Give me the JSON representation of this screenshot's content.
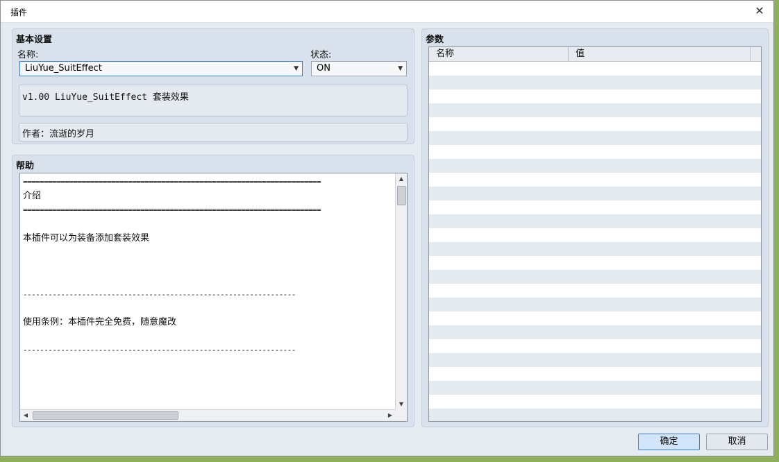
{
  "window": {
    "title": "插件",
    "close_glyph": "✕"
  },
  "basic": {
    "title": "基本设置",
    "name_label": "名称:",
    "name_value": "LiuYue_SuitEffect",
    "status_label": "状态:",
    "status_value": "ON",
    "description": "v1.00 LiuYue_SuitEffect 套装效果",
    "author": "作者：流逝的岁月"
  },
  "help": {
    "title": "帮助",
    "lines": [
      "=======================================================================",
      "介绍",
      "=======================================================================",
      "",
      "本插件可以为装备添加套装效果",
      "",
      "",
      "",
      "-----------------------------------------------------------------",
      "",
      "使用条例：本插件完全免费，随意魔改",
      "",
      "-----------------------------------------------------------------",
      "",
      "",
      "",
      ""
    ]
  },
  "params": {
    "title": "参数",
    "col_name": "名称",
    "col_value": "值",
    "row_count": 26
  },
  "buttons": {
    "ok": "确定",
    "cancel": "取消"
  },
  "icons": {
    "close": "close-icon",
    "dropdown": "chevron-down-icon",
    "scroll_up": "arrow-up-icon",
    "scroll_down": "arrow-down-icon",
    "scroll_left": "arrow-left-icon",
    "scroll_right": "arrow-right-icon"
  }
}
